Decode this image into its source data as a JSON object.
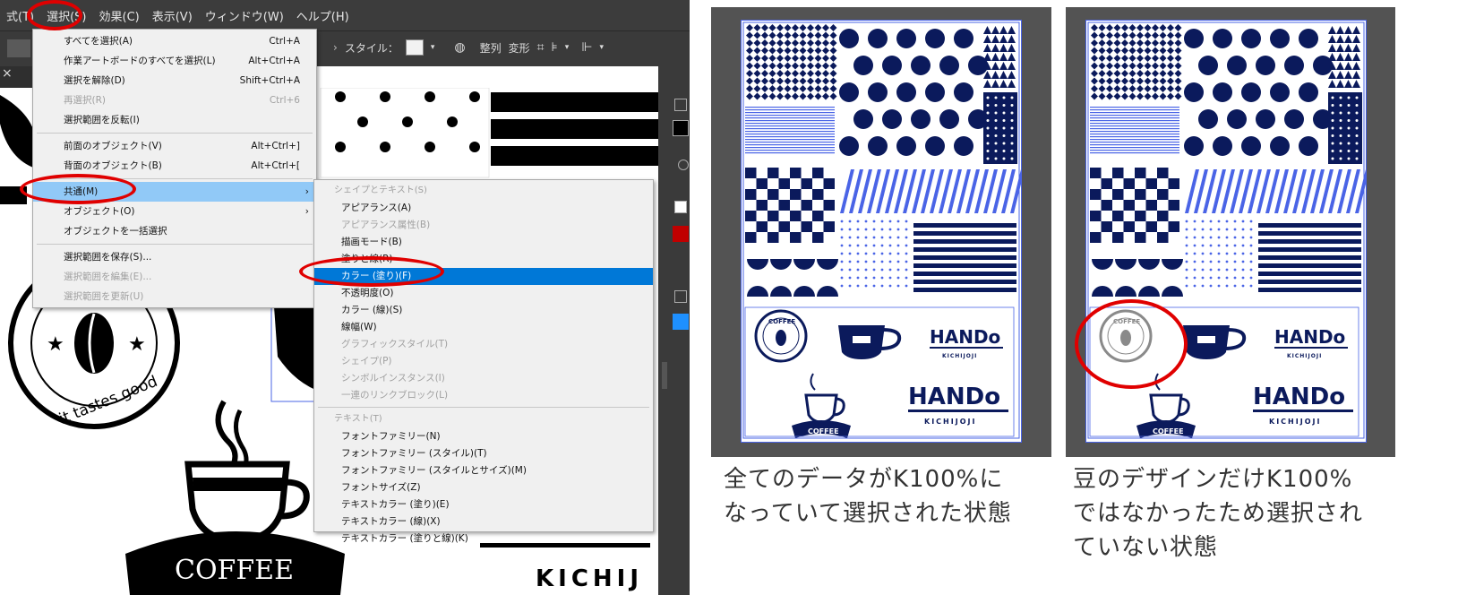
{
  "illustrator": {
    "menubar": [
      "式(T)",
      "選択(S)",
      "効果(C)",
      "表示(V)",
      "ウィンドウ(W)",
      "ヘルプ(H)"
    ],
    "toolbar": {
      "style_label": "スタイル：",
      "align_label": "整列",
      "transform_label": "変形"
    },
    "canvas_texts": {
      "tagline": "it tastes good",
      "coffee": "COFFEE",
      "kichijoji": "KICHIJ"
    },
    "select_menu": [
      {
        "label": "すべてを選択(A)",
        "shortcut": "Ctrl+A",
        "disabled": false
      },
      {
        "label": "作業アートボードのすべてを選択(L)",
        "shortcut": "Alt+Ctrl+A",
        "disabled": false
      },
      {
        "label": "選択を解除(D)",
        "shortcut": "Shift+Ctrl+A",
        "disabled": false
      },
      {
        "label": "再選択(R)",
        "shortcut": "Ctrl+6",
        "disabled": true
      },
      {
        "label": "選択範囲を反転(I)",
        "shortcut": "",
        "disabled": false
      },
      {
        "separator": true
      },
      {
        "label": "前面のオブジェクト(V)",
        "shortcut": "Alt+Ctrl+]",
        "disabled": false
      },
      {
        "label": "背面のオブジェクト(B)",
        "shortcut": "Alt+Ctrl+[",
        "disabled": false
      },
      {
        "separator": true
      },
      {
        "label": "共通(M)",
        "shortcut": "",
        "submenu": true,
        "highlight": true
      },
      {
        "label": "オブジェクト(O)",
        "shortcut": "",
        "submenu": true
      },
      {
        "label": "オブジェクトを一括選択",
        "shortcut": "",
        "disabled": false
      },
      {
        "separator": true
      },
      {
        "label": "選択範囲を保存(S)...",
        "shortcut": "",
        "disabled": false
      },
      {
        "label": "選択範囲を編集(E)...",
        "shortcut": "",
        "disabled": true
      },
      {
        "label": "選択範囲を更新(U)",
        "shortcut": "",
        "disabled": true
      }
    ],
    "common_submenu": {
      "header_shape": "シェイプとテキスト(S)",
      "shape_items": [
        {
          "label": "アピアランス(A)",
          "disabled": false
        },
        {
          "label": "アピアランス属性(B)",
          "disabled": true
        },
        {
          "label": "描画モード(B)",
          "disabled": false
        },
        {
          "label": "塗りと線(R)",
          "disabled": false
        },
        {
          "label": "カラー (塗り)(F)",
          "disabled": false,
          "selected": true
        },
        {
          "label": "不透明度(O)",
          "disabled": false
        },
        {
          "label": "カラー (線)(S)",
          "disabled": false
        },
        {
          "label": "線幅(W)",
          "disabled": false
        },
        {
          "label": "グラフィックスタイル(T)",
          "disabled": true
        },
        {
          "label": "シェイプ(P)",
          "disabled": true
        },
        {
          "label": "シンボルインスタンス(I)",
          "disabled": true
        },
        {
          "label": "一連のリンクブロック(L)",
          "disabled": true
        }
      ],
      "header_text": "テキスト(T)",
      "text_items": [
        {
          "label": "フォントファミリー(N)"
        },
        {
          "label": "フォントファミリー (スタイル)(T)"
        },
        {
          "label": "フォントファミリー (スタイルとサイズ)(M)"
        },
        {
          "label": "フォントサイズ(Z)"
        },
        {
          "label": "テキストカラー (塗り)(E)"
        },
        {
          "label": "テキストカラー (線)(X)"
        },
        {
          "label": "テキストカラー (塗りと線)(K)"
        }
      ]
    }
  },
  "panels": [
    {
      "logos": {
        "coffee": "COFFEE",
        "hando": "HANDo",
        "kichijoji": "KICHIJOJI"
      },
      "caption": [
        "全てのデータがK100%に",
        "なっていて選択された状態"
      ]
    },
    {
      "logos": {
        "coffee": "COFFEE",
        "hando": "HANDo",
        "kichijoji": "KICHIJOJI"
      },
      "caption": [
        "豆のデザインだけK100%",
        "ではなかったため選択され",
        "ていない状態"
      ]
    }
  ],
  "colors": {
    "selection_blue": "#4a64e6",
    "art_navy": "#0b1a5c",
    "highlight_red": "#e00000",
    "menu_hover": "#91c9f7",
    "menu_selected": "#0078d7"
  }
}
